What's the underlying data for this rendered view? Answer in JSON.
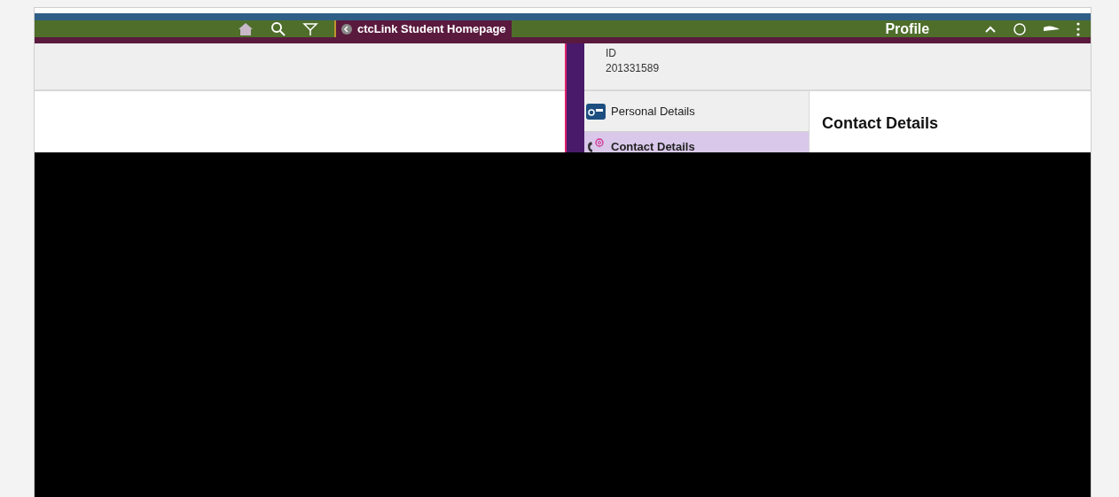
{
  "header": {
    "back_label": "ctcLink Student Homepage",
    "title": "Profile"
  },
  "identity": {
    "label": "ID",
    "value": "201331589"
  },
  "nav": [
    {
      "label": "Personal Details",
      "selected": false
    },
    {
      "label": "Contact Details",
      "selected": true
    }
  ],
  "content": {
    "title": "Contact Details"
  }
}
